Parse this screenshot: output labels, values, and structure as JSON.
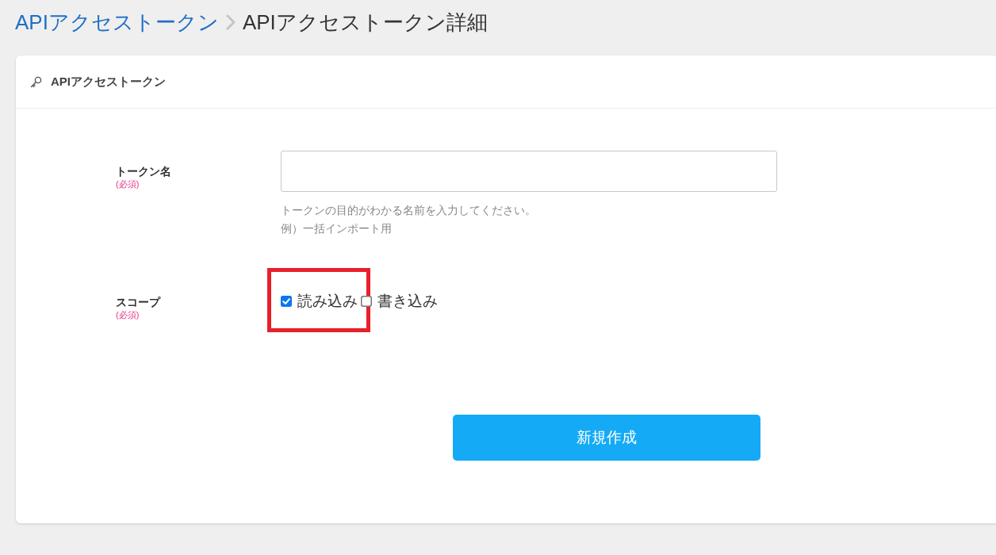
{
  "breadcrumb": {
    "items": [
      {
        "label": "APIアクセストークン",
        "kind": "link"
      },
      {
        "label": "APIアクセストークン詳細",
        "kind": "current"
      }
    ]
  },
  "card": {
    "title": "APIアクセストークン"
  },
  "form": {
    "fields": [
      {
        "kind": "text",
        "label": "トークン名",
        "required_mark": "(必須)",
        "help": [
          "トークンの目的がわかる名前を入力してください。",
          "例）一括インポート用"
        ]
      },
      {
        "kind": "checkboxes",
        "label": "スコープ",
        "required_mark": "(必須)",
        "options": [
          {
            "label": "読み込み",
            "checked": true,
            "highlighted": true
          },
          {
            "label": "書き込み",
            "checked": false,
            "highlighted": false
          }
        ]
      }
    ]
  },
  "submit": {
    "label": "新規作成"
  }
}
